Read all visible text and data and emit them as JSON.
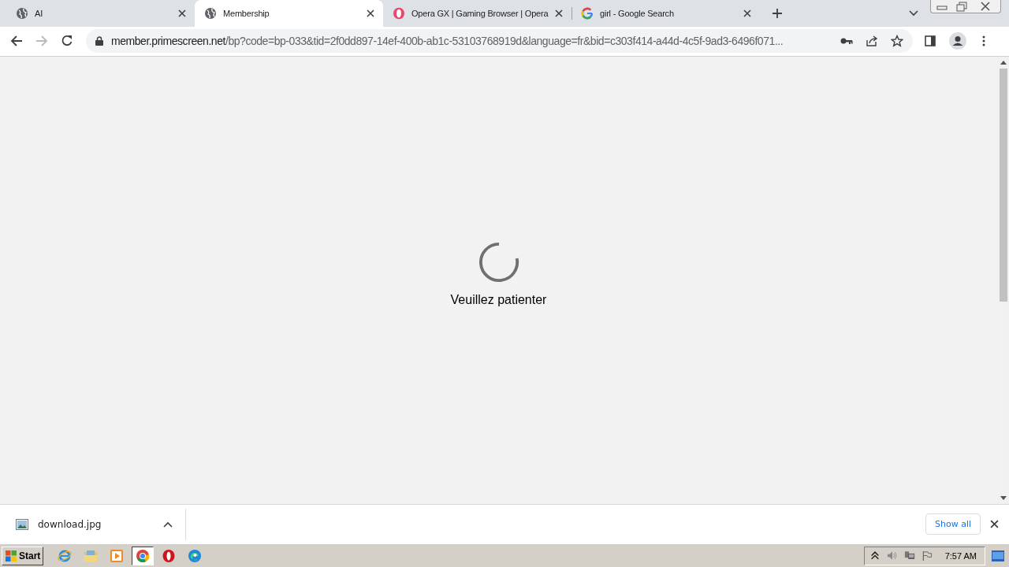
{
  "tabs": [
    {
      "title": "AI",
      "kind": "globe",
      "selected": false
    },
    {
      "title": "Membership",
      "kind": "globe",
      "selected": true
    },
    {
      "title": "Opera GX | Gaming Browser | Opera",
      "kind": "opera",
      "selected": false
    },
    {
      "title": "girl - Google Search",
      "kind": "google",
      "selected": false
    }
  ],
  "address": {
    "host": "member.primescreen.net",
    "path": "/bp?code=bp-033&tid=2f0dd897-14ef-400b-ab1c-53103768919d&language=fr&bid=c303f414-a44d-4c5f-9ad3-6496f071..."
  },
  "page": {
    "message": "Veuillez patienter"
  },
  "downloads": {
    "items": [
      {
        "name": "download.jpg"
      }
    ],
    "show_all": "Show all"
  },
  "taskbar": {
    "start": "Start",
    "apps": [
      {
        "kind": "ie",
        "selected": false
      },
      {
        "kind": "folder",
        "selected": false
      },
      {
        "kind": "media",
        "selected": false
      },
      {
        "kind": "chrome",
        "selected": true
      },
      {
        "kind": "opera",
        "selected": false
      },
      {
        "kind": "edge",
        "selected": false
      }
    ],
    "clock": "7:57 AM"
  }
}
